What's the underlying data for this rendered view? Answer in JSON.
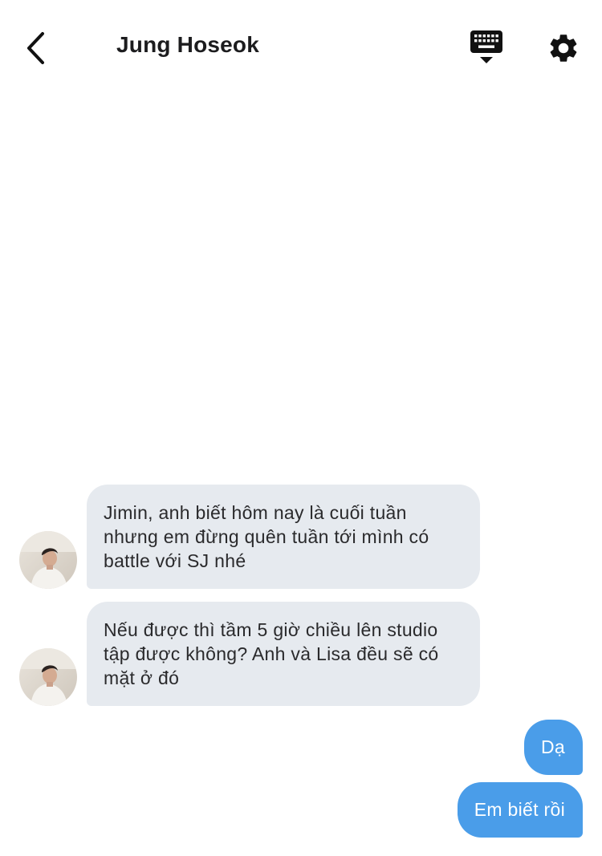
{
  "header": {
    "title": "Jung Hoseok",
    "back_icon": "chevron-left-icon",
    "keyboard_icon": "keyboard-hide-icon",
    "settings_icon": "gear-icon"
  },
  "messages": [
    {
      "direction": "incoming",
      "text": "Jimin, anh biết hôm nay là cuối tuần nhưng em đừng quên tuần tới mình có battle với SJ nhé"
    },
    {
      "direction": "incoming",
      "text": "Nếu được thì tầm 5 giờ chiều lên studio tập được không? Anh và Lisa đều sẽ có mặt ở đó"
    },
    {
      "direction": "outgoing",
      "text": "Dạ"
    },
    {
      "direction": "outgoing",
      "text": "Em biết rồi"
    }
  ],
  "colors": {
    "incoming_bubble": "#e6eaef",
    "outgoing_bubble": "#4a9de9",
    "title_text": "#1c1c1e"
  }
}
